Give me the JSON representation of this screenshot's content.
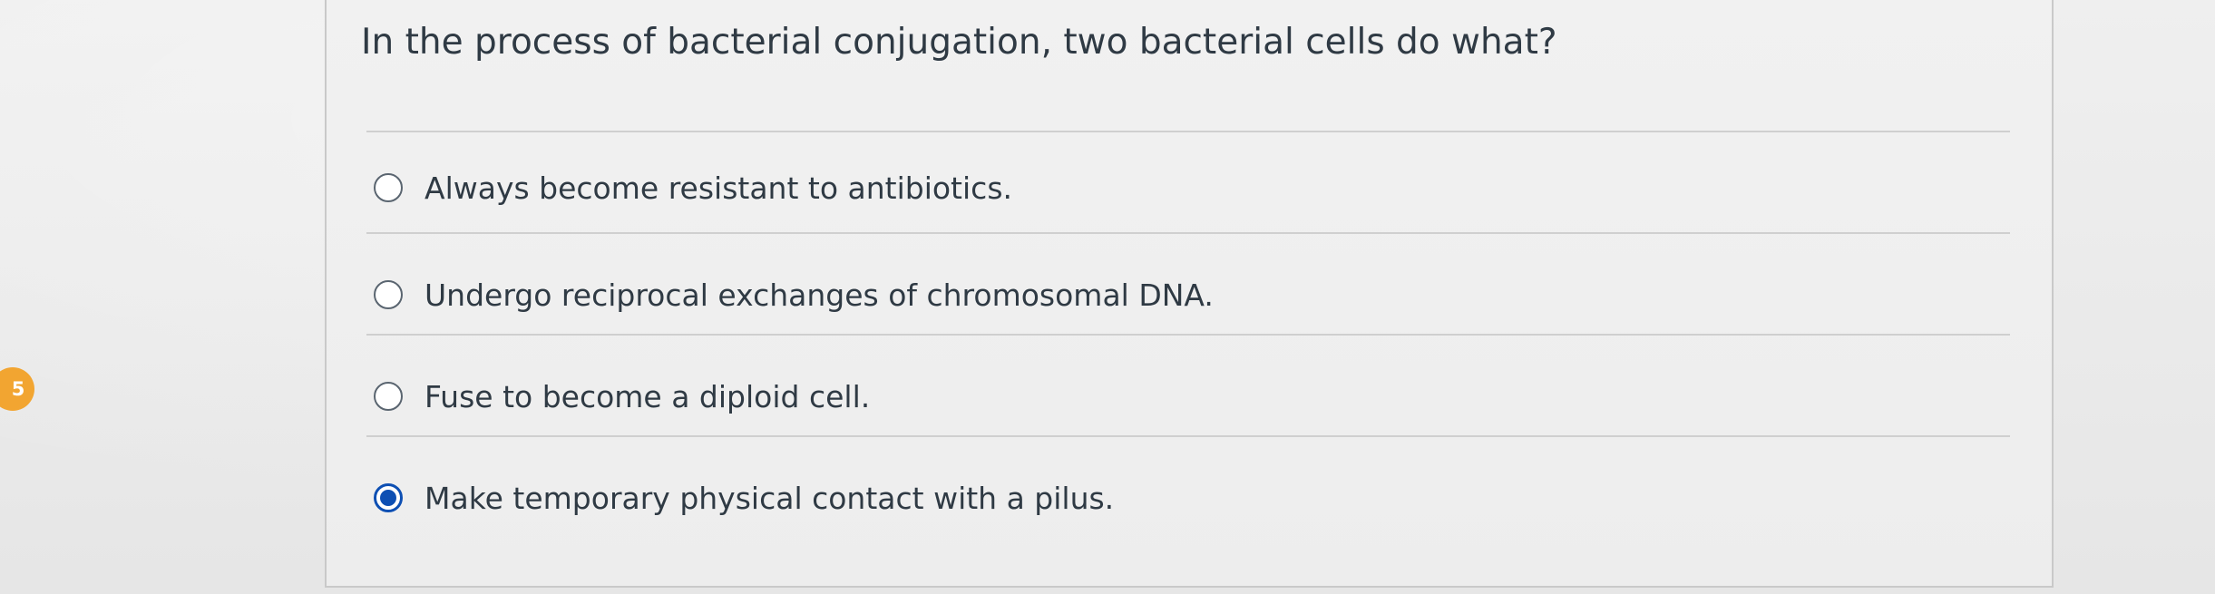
{
  "question": {
    "number": "5",
    "text": "In the process of bacterial conjugation, two bacterial cells do what?",
    "answers": [
      {
        "label": "Always become resistant to antibiotics.",
        "selected": false
      },
      {
        "label": "Undergo reciprocal exchanges of chromosomal DNA.",
        "selected": false
      },
      {
        "label": "Fuse to become a diploid cell.",
        "selected": false
      },
      {
        "label": "Make temporary physical contact with a pilus.",
        "selected": true
      }
    ]
  },
  "colors": {
    "badge": "#f2a531",
    "selected_radio": "#0d4fb3",
    "text": "#2f3a44"
  },
  "icons": {
    "unselected_radio": "radio-empty-icon",
    "selected_radio": "radio-selected-icon"
  }
}
